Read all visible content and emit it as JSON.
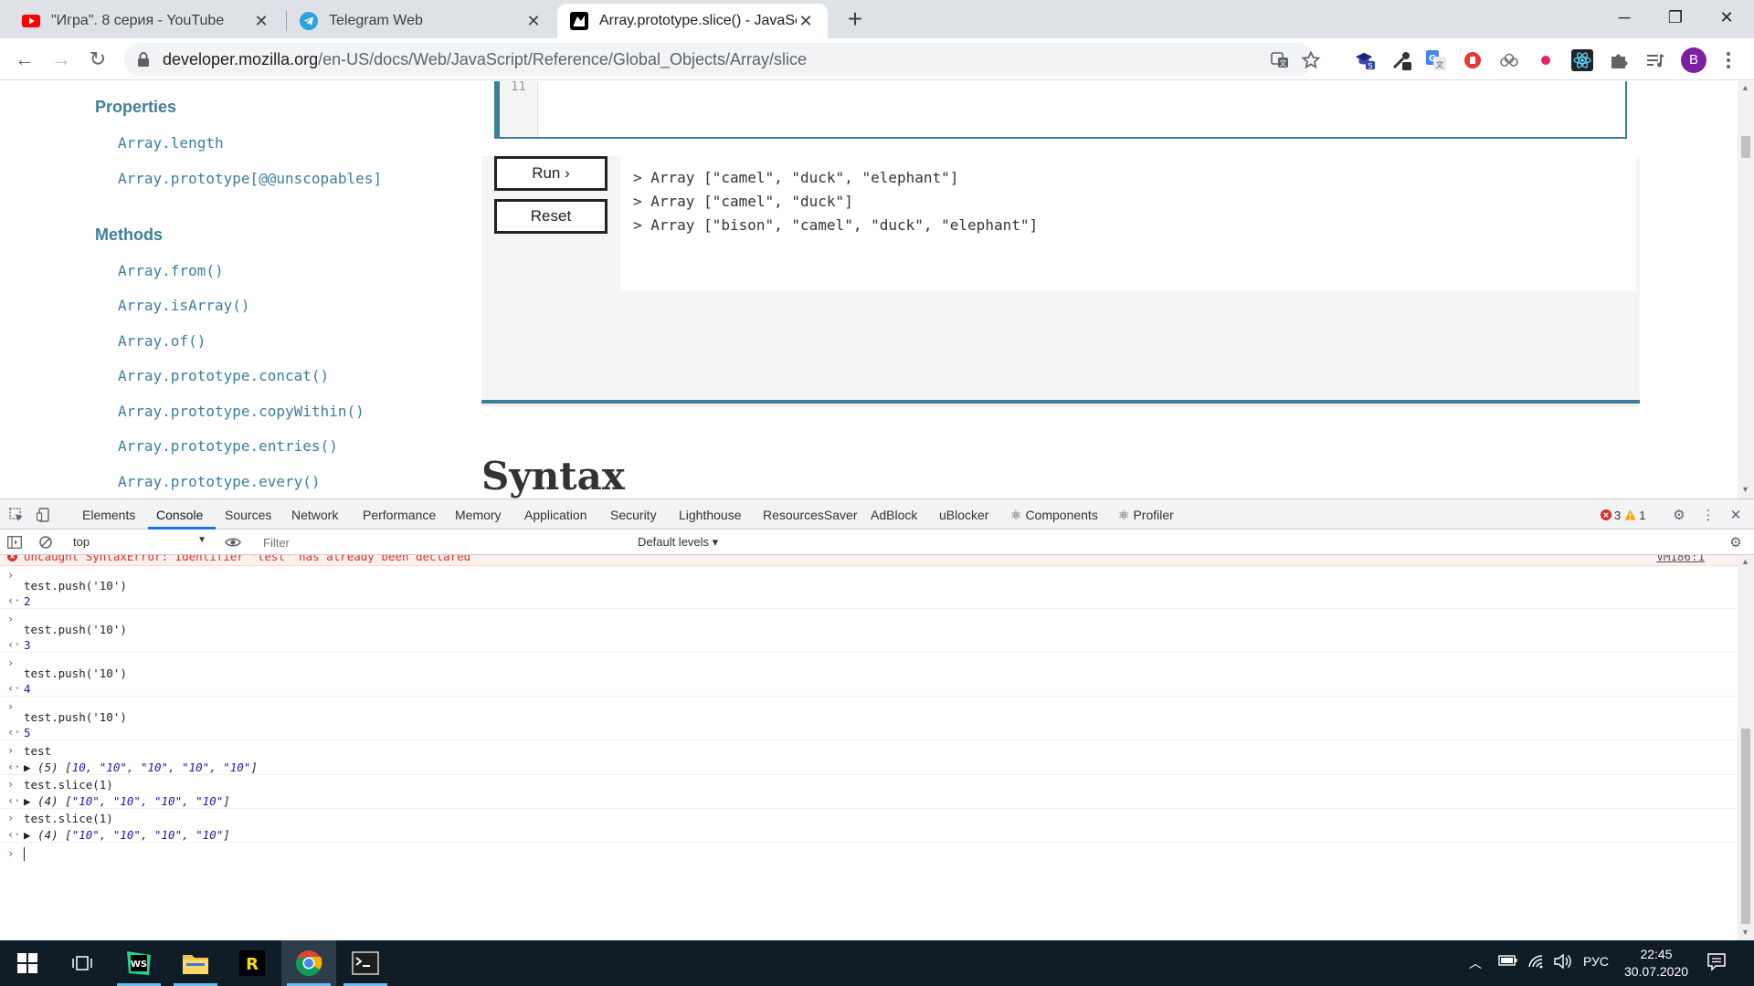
{
  "browser": {
    "tabs": [
      {
        "title": "\"Игра\". 8 серия - YouTube",
        "icon": "youtube-icon"
      },
      {
        "title": "Telegram Web",
        "icon": "telegram-icon"
      },
      {
        "title": "Array.prototype.slice() - JavaScrip",
        "icon": "mdn-icon",
        "active": true
      }
    ],
    "url_domain": "developer.mozilla.org",
    "url_path": "/en-US/docs/Web/JavaScript/Reference/Global_Objects/Array/slice",
    "profile_initial": "B"
  },
  "page": {
    "sidebar": {
      "properties_heading": "Properties",
      "properties": [
        "Array.length",
        "Array.prototype[@@unscopables]"
      ],
      "methods_heading": "Methods",
      "methods": [
        "Array.from()",
        "Array.isArray()",
        "Array.of()",
        "Array.prototype.concat()",
        "Array.prototype.copyWithin()",
        "Array.prototype.entries()",
        "Array.prototype.every()"
      ]
    },
    "editor": {
      "line_number": "11"
    },
    "run_label": "Run ›",
    "reset_label": "Reset",
    "output": [
      "> Array [\"camel\", \"duck\", \"elephant\"]",
      "> Array [\"camel\", \"duck\"]",
      "> Array [\"bison\", \"camel\", \"duck\", \"elephant\"]"
    ],
    "syntax_heading": "Syntax"
  },
  "devtools": {
    "tabs": [
      "Elements",
      "Console",
      "Sources",
      "Network",
      "Performance",
      "Memory",
      "Application",
      "Security",
      "Lighthouse",
      "ResourcesSaver",
      "AdBlock",
      "uBlocker",
      "⚛ Components",
      "⚛ Profiler"
    ],
    "active_tab": "Console",
    "error_count": "3",
    "warning_count": "1",
    "context": "top",
    "filter_placeholder": "Filter",
    "levels": "Default levels ▾",
    "error_message": "Uncaught SyntaxError: Identifier 'test' has already been declared",
    "error_source": "VM186:1",
    "entries": [
      {
        "input": "test.push('10')",
        "output": "2"
      },
      {
        "input": "test.push('10')",
        "output": "3"
      },
      {
        "input": "test.push('10')",
        "output": "4"
      },
      {
        "input": "test.push('10')",
        "output": "5"
      },
      {
        "input": "test",
        "output_prefix": "▶ (5) [",
        "output_items": "10, \"10\", \"10\", \"10\", \"10\"",
        "output_suffix": "]"
      },
      {
        "input": "test.slice(1)",
        "output_prefix": "▶ (4) [",
        "output_items": "\"10\", \"10\", \"10\", \"10\"",
        "output_suffix": "]"
      },
      {
        "input": "test.slice(1)",
        "output_prefix": "▶ (4) [",
        "output_items": "\"10\", \"10\", \"10\", \"10\"",
        "output_suffix": "]"
      }
    ]
  },
  "taskbar": {
    "apps": [
      "start-icon",
      "task-view-icon",
      "webstorm-icon",
      "file-explorer-icon",
      "rider-icon",
      "chrome-icon",
      "terminal-icon"
    ],
    "language": "РУС",
    "time": "22:45",
    "date": "30.07.2020"
  }
}
